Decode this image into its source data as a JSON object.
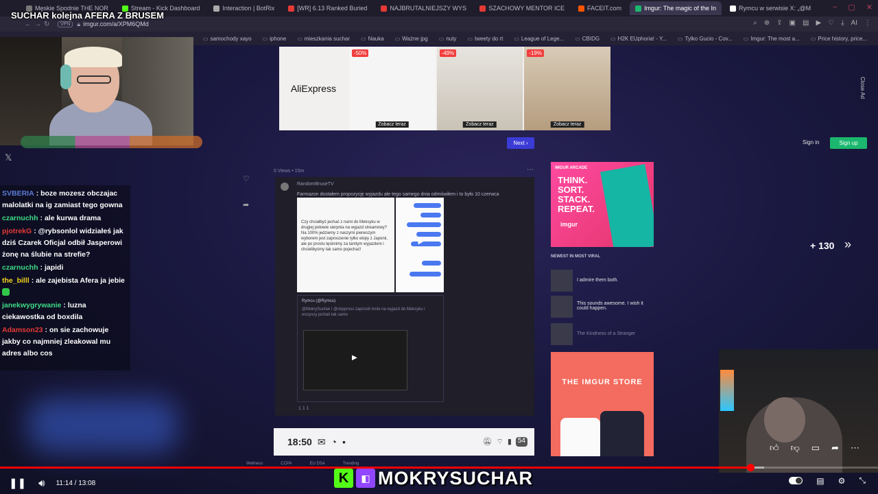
{
  "stream": {
    "title": "SUCHAR kolejna AFERA Z BRUSEM",
    "watermark": "MOKRYSUCHAR"
  },
  "browser": {
    "tabs": [
      {
        "label": "Męskie Spodnie THE NOR",
        "color": "#777777"
      },
      {
        "label": "Stream - Kick Dashboard",
        "color": "#53fc18"
      },
      {
        "label": "Interaction | BotRix",
        "color": "#aaaaaa"
      },
      {
        "label": "[WR] 6.13 Ranked Buried",
        "color": "#e53935"
      },
      {
        "label": "NAJBRUTALNIEJSZY WYS",
        "color": "#e53935"
      },
      {
        "label": "SZACHOWY MENTOR ICE",
        "color": "#e53935"
      },
      {
        "label": "FACEIT.com",
        "color": "#ff5500"
      },
      {
        "label": "Imgur: The magic of the In",
        "color": "#1bb76e",
        "active": true
      },
      {
        "label": "Rymcu w serwisie X: „@M",
        "color": "#ffffff"
      }
    ],
    "url": "imgur.com/a/XPM6QMd",
    "vpn": "VPN",
    "bookmarks": [
      "samochody xayo",
      "iphone",
      "mieszkania suchar",
      "Nauka",
      "Ważne jpg",
      "nuty",
      "tweety do rt",
      "League of Lege...",
      "CBIDG",
      "H2K EUphoria! - Y...",
      "Tylko Gucio - Cov...",
      "Imgur: The most a...",
      "Price history, price..."
    ]
  },
  "chat": [
    {
      "user": "SVBERIA",
      "color": "#5b7bd6",
      "text": "boze mozesz obczajac malolatki na ig zamiast tego gowna"
    },
    {
      "user": "czarnuchh",
      "color": "#3ddc84",
      "text": "ale kurwa drama"
    },
    {
      "user": "pjotrekG",
      "color": "#e53935",
      "text": "@rybsonlol widziałeś jak dziś Czarek Oficjal odbił Jasperowi żonę na ślubie na strefie?",
      "mention": "@rybsonlol"
    },
    {
      "user": "czarnuchh",
      "color": "#3ddc84",
      "text": "japidi"
    },
    {
      "user": "the_billl",
      "color": "#f5d623",
      "text": "ale zajebista Afera ja jebie"
    },
    {
      "user": "janekwygrywanie",
      "color": "#3ddc84",
      "text": "luzna ciekawostka od boxdila"
    },
    {
      "user": "Adamson23",
      "color": "#e53935",
      "text": "on sie zachowuje jakby co najmniej zleakowal mu adres albo cos"
    }
  ],
  "ad": {
    "brand": "AliExpress",
    "items": [
      {
        "discount": "-50%",
        "cta": "Zobacz teraz"
      },
      {
        "discount": "-49%",
        "cta": "Zobacz teraz"
      },
      {
        "discount": "-19%",
        "cta": "Zobacz teraz"
      }
    ],
    "close": "Close Ad"
  },
  "imgur": {
    "next": "Next",
    "signin": "Sign in",
    "signup": "Sign up",
    "views": "0 Views • 15m",
    "more_count": "+ 130",
    "newest_heading": "NEWEST IN MOST VIRAL",
    "newest": [
      {
        "title": "I admire them both."
      },
      {
        "title": "This sounds awesome. I wish it could happen."
      },
      {
        "title": "The Kindness of a Stranger"
      }
    ],
    "arcade": {
      "label": "IMGUR ARCADE",
      "headline": "THINK.\nSORT.\nSTACK.\nREPEAT.",
      "brand": "imgur"
    },
    "store": {
      "title": "THE IMGUR STORE",
      "brand": "imgur"
    },
    "footer": [
      "Wellness",
      "CCPA",
      "EU DSA",
      "Trending"
    ]
  },
  "post": {
    "author": "RandomBruseTV",
    "header_text": "Farmazon dostałem propozycję wyjazdu ale tego samego dnia odmówiłem i to było 10 czerwca",
    "chat_text": "Czy chciałbyś jechać z nami do Meksyku w drugiej połowie sierpnia na wyjazd streamowy? Na 100% jedziemy z naszymi pierwszym wyborem jest zaproszenie tylko ekipy z Japonii, ale po prostu tęsknimy za tamtym wyjazdem i chcielibyśmy tak samo pojechać!",
    "quote_author": "Rymcu (@Rymcu)",
    "quote_text": "@MokrySuchar i @ckppross zaprosili mnie na wyjazd do Meksyku i wszyscy jechali tak samo",
    "footer": "1  1  1"
  },
  "phone": {
    "time": "18:50",
    "badge": "54"
  },
  "player": {
    "current_time": "11:14",
    "duration": "13:08",
    "timecode": "11:14 / 13:08",
    "progress": 0.855,
    "buffered": 0.87
  }
}
